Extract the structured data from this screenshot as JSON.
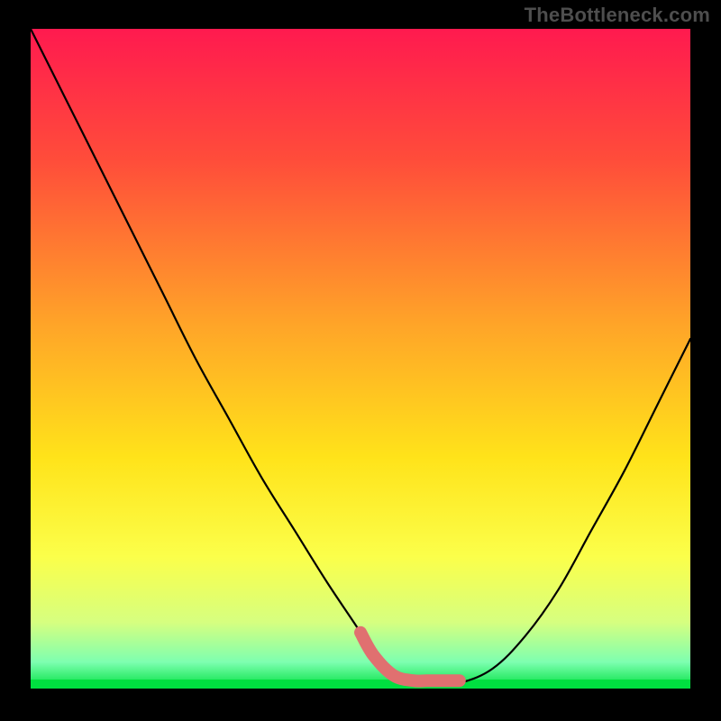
{
  "attribution": "TheBottleneck.com",
  "chart_data": {
    "type": "line",
    "title": "",
    "xlabel": "",
    "ylabel": "",
    "xlim": [
      0,
      100
    ],
    "ylim": [
      0,
      100
    ],
    "grid": false,
    "series": [
      {
        "name": "bottleneck-curve",
        "x": [
          0,
          5,
          10,
          15,
          20,
          25,
          30,
          35,
          40,
          45,
          50,
          52,
          55,
          58,
          60,
          62,
          65,
          70,
          75,
          80,
          85,
          90,
          95,
          100
        ],
        "y": [
          100,
          90,
          80,
          70,
          60,
          50,
          41,
          32,
          24,
          16,
          8.5,
          5,
          2,
          0.8,
          0.5,
          0.5,
          0.8,
          3,
          8,
          15,
          24,
          33,
          43,
          53
        ]
      }
    ],
    "background_gradient": {
      "stops": [
        {
          "offset": 0.0,
          "color": "#ff1a4f"
        },
        {
          "offset": 0.2,
          "color": "#ff4d3a"
        },
        {
          "offset": 0.45,
          "color": "#ffa528"
        },
        {
          "offset": 0.65,
          "color": "#ffe31a"
        },
        {
          "offset": 0.8,
          "color": "#fbff4a"
        },
        {
          "offset": 0.9,
          "color": "#d6ff80"
        },
        {
          "offset": 0.96,
          "color": "#7dffb0"
        },
        {
          "offset": 1.0,
          "color": "#00e040"
        }
      ]
    },
    "highlight_range_x": [
      50,
      65
    ],
    "highlight_color": "#e07070"
  }
}
